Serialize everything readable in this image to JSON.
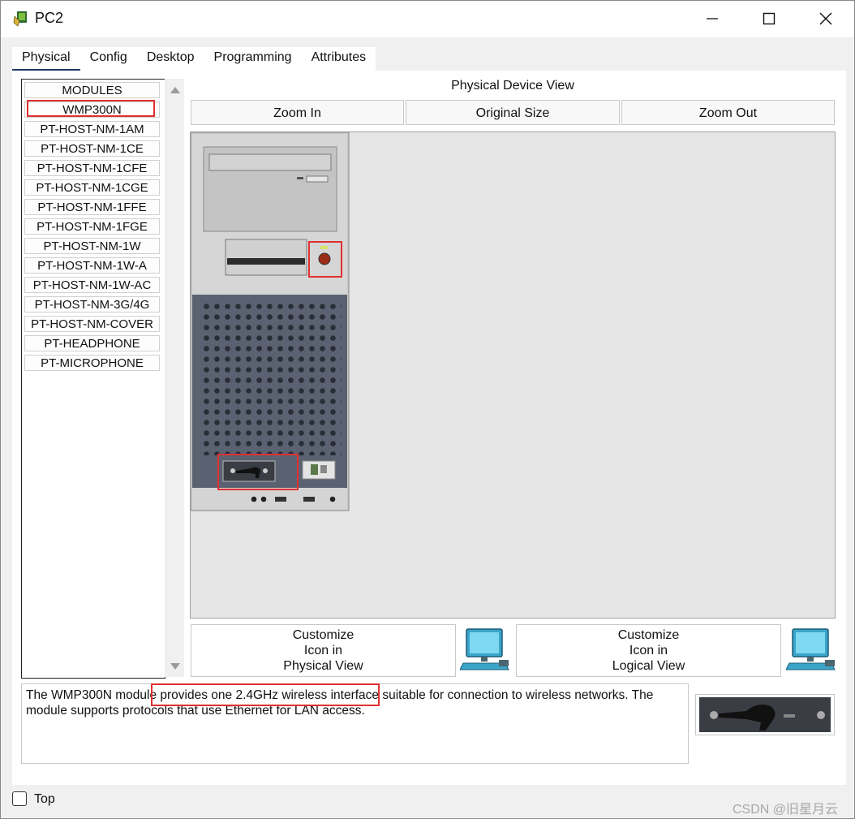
{
  "window": {
    "title": "PC2"
  },
  "icons": {
    "app": "packet-tracer-pc-icon",
    "minimize": "minimize-icon",
    "maximize": "maximize-icon",
    "close": "close-icon"
  },
  "tabs": [
    "Physical",
    "Config",
    "Desktop",
    "Programming",
    "Attributes"
  ],
  "modules": {
    "header": "MODULES",
    "items": [
      "WMP300N",
      "PT-HOST-NM-1AM",
      "PT-HOST-NM-1CE",
      "PT-HOST-NM-1CFE",
      "PT-HOST-NM-1CGE",
      "PT-HOST-NM-1FFE",
      "PT-HOST-NM-1FGE",
      "PT-HOST-NM-1W",
      "PT-HOST-NM-1W-A",
      "PT-HOST-NM-1W-AC",
      "PT-HOST-NM-3G/4G",
      "PT-HOST-NM-COVER",
      "PT-HEADPHONE",
      "PT-MICROPHONE"
    ],
    "selected": "WMP300N"
  },
  "physical_view": {
    "label": "Physical Device View",
    "zoom_in": "Zoom In",
    "original_size": "Original Size",
    "zoom_out": "Zoom Out"
  },
  "customize": {
    "physical": [
      "Customize",
      "Icon in",
      "Physical View"
    ],
    "logical": [
      "Customize",
      "Icon in",
      "Logical View"
    ]
  },
  "description": "The WMP300N module provides one 2.4GHz wireless interface suitable for connection to wireless networks. The module supports protocols that use Ethernet for LAN access.",
  "footer": {
    "top_label": "Top",
    "top_checked": false
  },
  "watermark": "CSDN @旧星月云",
  "colors": {
    "highlight": "#e03030",
    "tab_underline": "#1f3b64",
    "pc_case": "#d4d4d4",
    "pc_lower": "#5a6272"
  }
}
